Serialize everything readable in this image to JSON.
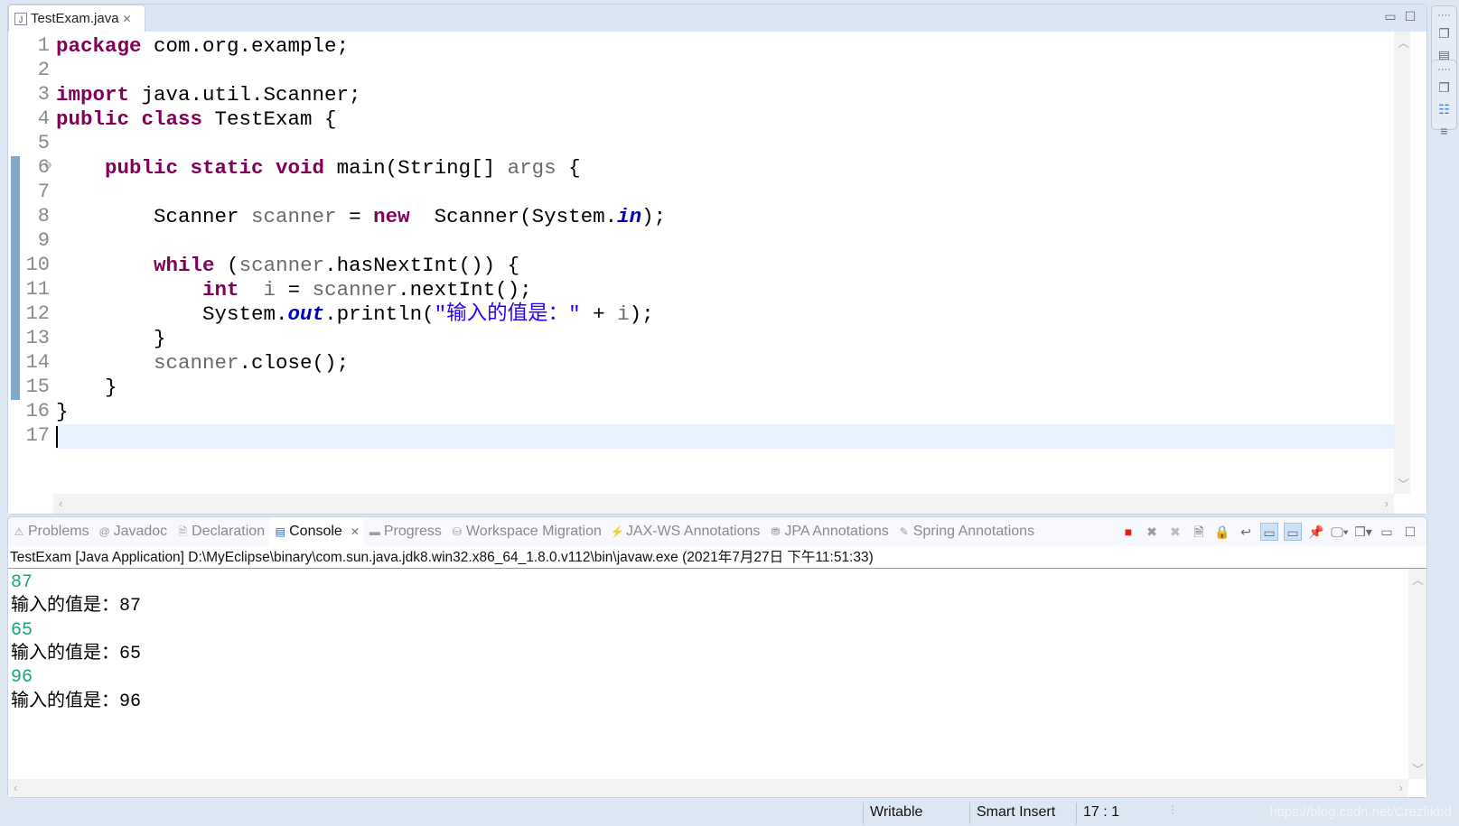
{
  "editor": {
    "tab": {
      "title": "TestExam.java",
      "icon": "java-file-icon"
    },
    "current_line": 17,
    "changed_lines": [
      6,
      15
    ],
    "lines": [
      [
        [
          "k",
          "package"
        ],
        [
          "",
          "com.org.example;"
        ]
      ],
      [],
      [
        [
          "k",
          "import"
        ],
        [
          "",
          "java.util.Scanner;"
        ]
      ],
      [
        [
          "k",
          "public"
        ],
        [
          "k",
          "class"
        ],
        [
          "",
          "TestExam {"
        ]
      ],
      [],
      [
        [
          "",
          "    "
        ],
        [
          "k",
          "public"
        ],
        [
          "k",
          "static"
        ],
        [
          "k",
          "void"
        ],
        [
          "",
          "main(String[] "
        ],
        [
          "v",
          "args"
        ],
        [
          "",
          " {"
        ]
      ],
      [],
      [
        [
          "",
          "        Scanner "
        ],
        [
          "v",
          "scanner"
        ],
        [
          "",
          " = "
        ],
        [
          "k",
          "new"
        ],
        [
          "",
          " Scanner(System."
        ],
        [
          "f",
          "in"
        ],
        [
          "",
          ");"
        ]
      ],
      [],
      [
        [
          "",
          "        "
        ],
        [
          "k",
          "while"
        ],
        [
          "",
          "("
        ],
        [
          "v",
          "scanner"
        ],
        [
          "",
          ".hasNextInt()) {"
        ]
      ],
      [
        [
          "",
          "            "
        ],
        [
          "k",
          "int"
        ],
        [
          "",
          ""
        ],
        [
          "v",
          " i"
        ],
        [
          "",
          " = "
        ],
        [
          "v",
          "scanner"
        ],
        [
          "",
          ".nextInt();"
        ]
      ],
      [
        [
          "",
          "            System."
        ],
        [
          "f",
          "out"
        ],
        [
          "",
          ".println("
        ],
        [
          "s",
          "\"输入的值是：\""
        ],
        [
          "",
          " + "
        ],
        [
          "v",
          "i"
        ],
        [
          "",
          ");"
        ]
      ],
      [
        [
          "",
          "        }"
        ]
      ],
      [
        [
          "",
          "        "
        ],
        [
          "v",
          "scanner"
        ],
        [
          "",
          ".close();"
        ]
      ],
      [
        [
          "",
          "    }"
        ]
      ],
      [
        [
          "",
          "}"
        ]
      ],
      []
    ]
  },
  "bottom_panel": {
    "tabs": [
      {
        "label": "Problems",
        "icon": "problems-icon",
        "active": false
      },
      {
        "label": "Javadoc",
        "icon": "at-icon",
        "active": false
      },
      {
        "label": "Declaration",
        "icon": "declaration-icon",
        "active": false
      },
      {
        "label": "Console",
        "icon": "console-icon",
        "active": true
      },
      {
        "label": "Progress",
        "icon": "progress-icon",
        "active": false
      },
      {
        "label": "Workspace Migration",
        "icon": "migration-icon",
        "active": false
      },
      {
        "label": "JAX-WS Annotations",
        "icon": "jaxws-icon",
        "active": false
      },
      {
        "label": "JPA Annotations",
        "icon": "jpa-icon",
        "active": false
      },
      {
        "label": "Spring Annotations",
        "icon": "spring-icon",
        "active": false
      }
    ],
    "console": {
      "header": "TestExam [Java Application] D:\\MyEclipse\\binary\\com.sun.java.jdk8.win32.x86_64_1.8.0.v112\\bin\\javaw.exe (2021年7月27日 下午11:51:33)",
      "lines": [
        {
          "text": "87",
          "type": "input"
        },
        {
          "text": "输入的值是：87",
          "type": "output"
        },
        {
          "text": "65",
          "type": "input"
        },
        {
          "text": "输入的值是：65",
          "type": "output"
        },
        {
          "text": "96",
          "type": "input"
        },
        {
          "text": "输入的值是：96",
          "type": "output"
        }
      ]
    }
  },
  "status": {
    "mode": "Writable",
    "insert": "Smart Insert",
    "position": "17 : 1"
  },
  "watermark": "https://blog.csdn.net/Crezfikbd",
  "colors": {
    "keyword": "#7f0055",
    "string": "#2a00ff",
    "static_field": "#0000c0",
    "console_input": "#1aa37a"
  }
}
